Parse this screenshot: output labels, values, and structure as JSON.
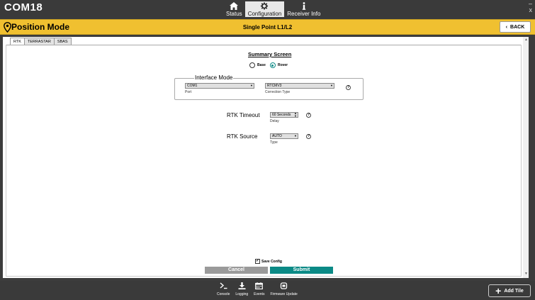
{
  "app": {
    "title": "COM18",
    "window_controls": [
      "–",
      "x"
    ]
  },
  "nav": {
    "items": [
      {
        "label": "Status",
        "icon": "home-icon",
        "active": false
      },
      {
        "label": "Configuration",
        "icon": "gear-icon",
        "active": true
      },
      {
        "label": "Receiver Info",
        "icon": "info-icon",
        "active": false
      }
    ]
  },
  "header": {
    "title": "Position Mode",
    "mode": "Single Point L1/L2",
    "back_label": "BACK",
    "back_icon": "‹",
    "color": "#f0c030"
  },
  "tabs": [
    {
      "label": "RTK",
      "active": true
    },
    {
      "label": "TERRASTAR",
      "active": false
    },
    {
      "label": "SBAS",
      "active": false
    }
  ],
  "summary": {
    "title": "Summary Screen",
    "options": [
      {
        "label": "Base",
        "selected": false
      },
      {
        "label": "Rover",
        "selected": true
      }
    ]
  },
  "interface_mode": {
    "legend": "Interface Mode",
    "port_value": "COM1",
    "port_label": "Port",
    "correction_value": "RTCMV3",
    "correction_label": "Correction Type",
    "help": "?"
  },
  "rtk_timeout": {
    "label": "RTK Timeout",
    "value": "60 Seconds",
    "sublabel": "Delay",
    "help": "?"
  },
  "rtk_source": {
    "label": "RTK Source",
    "value": "AUTO",
    "sublabel": "Type",
    "help": "?"
  },
  "footer_actions": {
    "save_config_label": "Save Config",
    "save_config_checked": true,
    "checkmark": "✓",
    "cancel_label": "Cancel",
    "submit_label": "Submit",
    "accent": "#0b8a86"
  },
  "bottom_tools": [
    {
      "label": "Console",
      "icon": "console-icon"
    },
    {
      "label": "Logging",
      "icon": "download-icon"
    },
    {
      "label": "Events",
      "icon": "calendar-icon"
    },
    {
      "label": "Firmware Update",
      "icon": "firmware-icon"
    }
  ],
  "add_tile": {
    "label": "Add Tile",
    "icon": "plus-icon",
    "symbol": "+"
  }
}
